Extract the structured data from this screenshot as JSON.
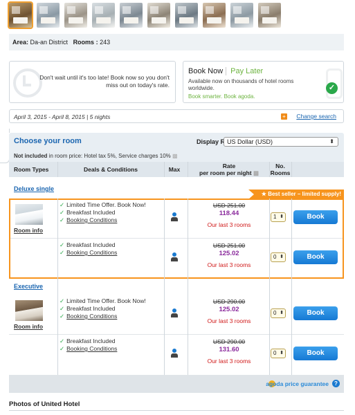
{
  "area_bar": {
    "area_label": "Area:",
    "area_value": "Da-an District",
    "rooms_label": "Rooms :",
    "rooms_value": "243"
  },
  "promo_urgency": {
    "text": "Don't wait until it's too late! Book now so you don't miss out on today's rate."
  },
  "promo_book_now": {
    "title": "Book Now",
    "title_accent": "Pay Later",
    "subtitle": "Available now on thousands of hotel rooms worldwide.",
    "tagline": "Book smarter. Book agoda."
  },
  "dates_bar": {
    "dates": "April 3, 2015 - April 8, 2015 | 5 nights",
    "change_search": "Change search"
  },
  "room_panel": {
    "title": "Choose your room",
    "display_rates_label": "Display Rates in",
    "currency_selected": "US Dollar (USD)",
    "not_included_label": "Not included",
    "not_included_text": "in room price: Hotel tax 5%, Service charges 10%",
    "columns": {
      "room_types": "Room Types",
      "deals": "Deals & Conditions",
      "max": "Max",
      "rate_line1": "Rate",
      "rate_line2": "per room per night",
      "no_rooms_line1": "No.",
      "no_rooms_line2": "Rooms"
    },
    "best_seller": "Best seller – limited supply!",
    "room_info": "Room info",
    "groups": [
      {
        "name": "Deluxe single",
        "offers": [
          {
            "deals": [
              "Limited Time Offer. Book Now!",
              "Breakfast Included",
              "Booking Conditions"
            ],
            "old_price": "USD 251.00",
            "new_price": "118.44",
            "scarcity": "Our last 3 rooms",
            "qty": "1",
            "book": "Book"
          },
          {
            "deals": [
              "Breakfast Included",
              "Booking Conditions"
            ],
            "old_price": "USD 251.00",
            "new_price": "125.02",
            "scarcity": "Our last 3 rooms",
            "qty": "0",
            "book": "Book"
          }
        ]
      },
      {
        "name": "Executive",
        "offers": [
          {
            "deals": [
              "Limited Time Offer. Book Now!",
              "Breakfast Included",
              "Booking Conditions"
            ],
            "old_price": "USD 290.00",
            "new_price": "125.02",
            "scarcity": "Our last 3 rooms",
            "qty": "0",
            "book": "Book"
          },
          {
            "deals": [
              "Breakfast Included",
              "Booking Conditions"
            ],
            "old_price": "USD 290.00",
            "new_price": "131.60",
            "scarcity": "Our last 3 rooms",
            "qty": "0",
            "book": "Book"
          }
        ]
      }
    ],
    "guarantee": "agoda price guarantee"
  },
  "photos_heading": "Photos of United Hotel",
  "colors": {
    "link_blue": "#1a65b0",
    "accent_orange": "#f7941d",
    "price_purple": "#8a2a9c",
    "scarcity_red": "#d01818",
    "book_blue": "#1679d4",
    "green": "#2aa84a"
  }
}
